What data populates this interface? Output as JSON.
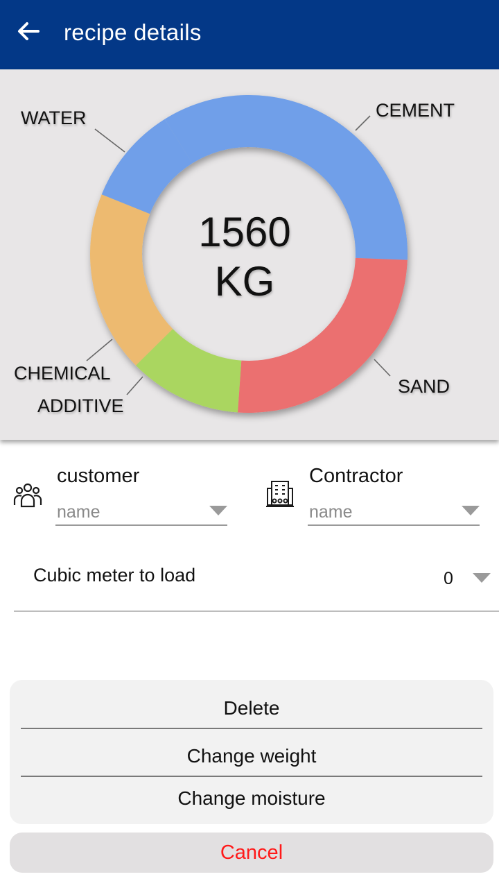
{
  "appbar": {
    "title": "recipe details",
    "back_icon": "arrow-left-icon",
    "background": "#033887"
  },
  "chart_data": {
    "type": "pie",
    "style": "donut",
    "center_value": "1560",
    "center_unit": "KG",
    "slices": [
      {
        "name": "CEMENT",
        "share": 0.345,
        "color": "#6f9fe9"
      },
      {
        "name": "SAND",
        "share": 0.255,
        "color": "#eb6f6f"
      },
      {
        "name": "CHEMICAL ADDITIVE",
        "share": 0.115,
        "color": "#aad660"
      },
      {
        "name": "WATER",
        "share": 0.185,
        "color": "#edba70"
      },
      {
        "name": "",
        "share": 0.1,
        "color": "#6f9fe9"
      }
    ],
    "labels": {
      "water": "WATER",
      "cement": "CEMENT",
      "sand": "SAND",
      "chemical_line1": "CHEMICAL",
      "chemical_line2": "ADDITIVE"
    }
  },
  "customer": {
    "title": "customer",
    "icon": "people-icon",
    "placeholder": "name"
  },
  "contractor": {
    "title": "Contractor",
    "icon": "building-icon",
    "placeholder": "name"
  },
  "cubic": {
    "label": "Cubic meter to load",
    "value": "0"
  },
  "actions": {
    "delete": "Delete",
    "change_weight": "Change weight",
    "change_moisture": "Change moisture",
    "cancel": "Cancel",
    "cancel_color": "#ff1a1a"
  }
}
